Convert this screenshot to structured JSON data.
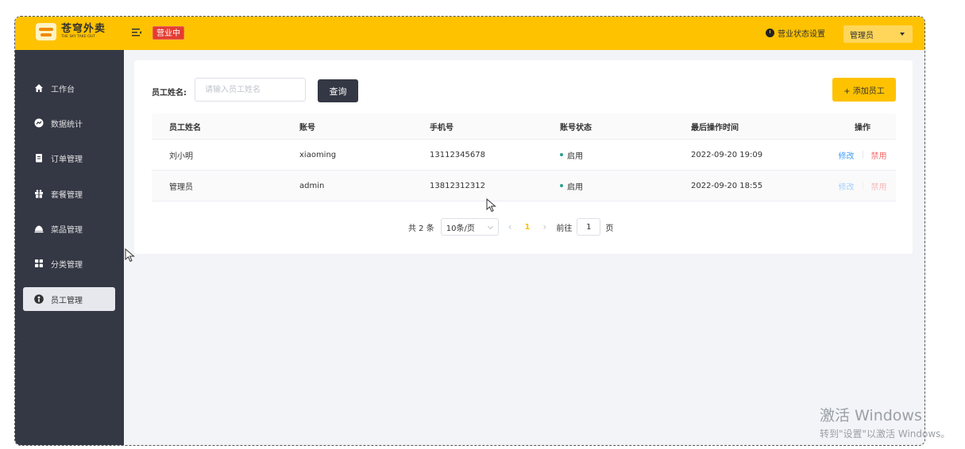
{
  "header": {
    "logo_cn": "苍穹外卖",
    "logo_en": "THE SKY TAKE-OUT",
    "status_tag": "营业中",
    "shop_setting": "营业状态设置",
    "user": "管理员",
    "brand_color": "#ffc200"
  },
  "sidebar": {
    "items": [
      {
        "label": "工作台",
        "icon": "home-icon"
      },
      {
        "label": "数据统计",
        "icon": "chart-icon"
      },
      {
        "label": "订单管理",
        "icon": "clipboard-icon"
      },
      {
        "label": "套餐管理",
        "icon": "gift-icon"
      },
      {
        "label": "菜品管理",
        "icon": "dish-icon"
      },
      {
        "label": "分类管理",
        "icon": "grid-icon"
      },
      {
        "label": "员工管理",
        "icon": "person-icon"
      }
    ],
    "active": "员工管理"
  },
  "search": {
    "label": "员工姓名:",
    "placeholder": "请输入员工姓名",
    "query_button": "查询",
    "add_button": "+ 添加员工"
  },
  "table": {
    "columns": [
      "员工姓名",
      "账号",
      "手机号",
      "账号状态",
      "最后操作时间",
      "操作"
    ],
    "rows": [
      {
        "name": "刘小明",
        "account": "xiaoming",
        "phone": "13112345678",
        "status": "启用",
        "time": "2022-09-20 19:09",
        "edit": "修改",
        "disable": "禁用"
      },
      {
        "name": "管理员",
        "account": "admin",
        "phone": "13812312312",
        "status": "启用",
        "time": "2022-09-20 18:55",
        "edit": "修改",
        "disable": "禁用"
      }
    ]
  },
  "pagination": {
    "total": "共 2 条",
    "page_size": "10条/页",
    "current": "1",
    "goto_label": "前往",
    "goto_value": "1",
    "page_unit": "页"
  },
  "watermark": {
    "title": "激活 Windows",
    "subtitle": "转到\"设置\"以激活 Windows。"
  }
}
